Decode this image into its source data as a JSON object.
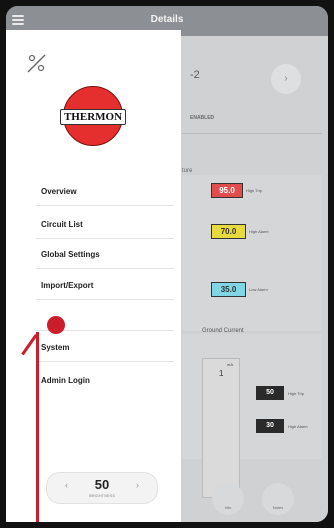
{
  "header": {
    "title": "Details"
  },
  "background": {
    "circuit_suffix": "-2",
    "enabled_text": "ENABLED",
    "temperature_header": "ture",
    "high_trip_value": "95.0",
    "high_trip_label": "High Trip",
    "high_alarm_value": "70.0",
    "high_alarm_label": "High Alarm",
    "low_alarm_value": "35.0",
    "low_alarm_label": "Low Alarm",
    "ground_current_header": "Ground Current",
    "gauge_value": "1",
    "gauge_unit": "mA",
    "gc_high_trip_value": "50",
    "gc_high_trip_label": "High Trip",
    "gc_high_alarm_value": "30",
    "gc_high_alarm_label": "High Alarm",
    "bottom_btn1": "Info",
    "bottom_btn2": "Notes",
    "round_button_glyph": "›"
  },
  "drawer": {
    "logo_text": "THERMON",
    "nav": [
      {
        "label": "Overview"
      },
      {
        "label": "Circuit List"
      },
      {
        "label": "Global Settings"
      },
      {
        "label": "Import/Export"
      },
      {
        "label": "System"
      },
      {
        "label": "Admin Login"
      }
    ],
    "brightness": {
      "value": "50",
      "label": "BRIGHTNESS",
      "left": "‹",
      "right": "›"
    }
  },
  "colors": {
    "accent_red": "#cc1d2a",
    "topbar": "#8c8f93"
  }
}
